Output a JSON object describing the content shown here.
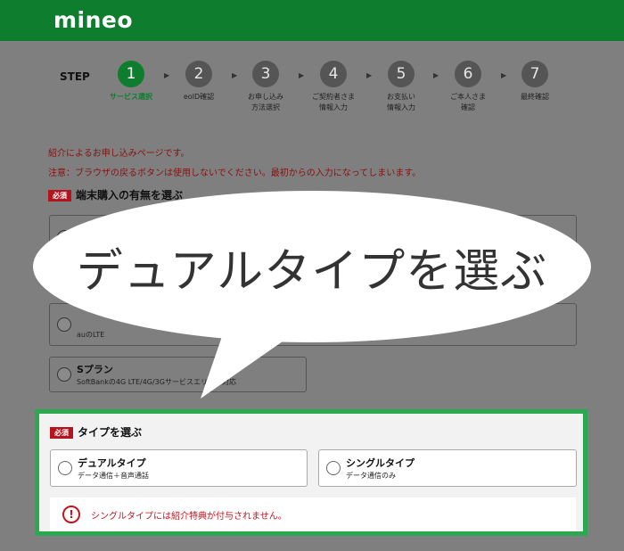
{
  "header": {
    "logo": "mineo"
  },
  "steps": {
    "label": "STEP",
    "items": [
      {
        "num": "1",
        "text": "サービス選択",
        "active": true
      },
      {
        "num": "2",
        "text": "eoID確認"
      },
      {
        "num": "3",
        "text": "お申し込み\n方法選択"
      },
      {
        "num": "4",
        "text": "ご契約者さま\n情報入力"
      },
      {
        "num": "5",
        "text": "お支払い\n情報入力"
      },
      {
        "num": "6",
        "text": "ご本人さま\n確認"
      },
      {
        "num": "7",
        "text": "最終確認"
      }
    ]
  },
  "notices": {
    "referral": "紹介によるお申し込みページです。",
    "warning": "注意：ブラウザの戻るボタンは使用しないでください。最初からの入力になってしまいます。"
  },
  "device_section": {
    "required": "必須",
    "title": "端末購入の有無を選ぶ",
    "option_a_sub": "auのLTE",
    "option_s_title": "Sプラン",
    "option_s_sub": "SoftBankの4G LTE/4G/3Gサービスエリアに対応"
  },
  "callout": {
    "text": "デュアルタイプを選ぶ"
  },
  "type_section": {
    "required": "必須",
    "title": "タイプを選ぶ",
    "dual": {
      "title": "デュアルタイプ",
      "sub": "データ通信＋音声通話"
    },
    "single": {
      "title": "シングルタイプ",
      "sub": "データ通信のみ"
    },
    "warning_icon": "!",
    "warning_text": "シングルタイプには紹介特典が付与されません。"
  },
  "colors": {
    "brand": "#0e7d2d",
    "highlight": "#2aa94e",
    "required": "#b3141e",
    "warning": "#c8141e"
  }
}
